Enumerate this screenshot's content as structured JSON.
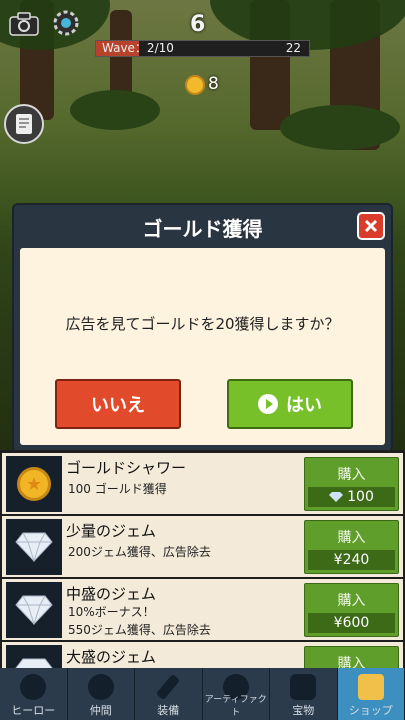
{
  "hud": {
    "stage_number": "6",
    "wave_label": "Wave：2/10",
    "wave_progress": 0.2,
    "wave_remaining": "22",
    "gold": "8"
  },
  "dialog": {
    "title": "ゴールド獲得",
    "message": "広告を見てゴールドを20獲得しますか？",
    "no_label": "いいえ",
    "yes_label": "はい"
  },
  "shop": {
    "items": [
      {
        "name": "ゴールドシャワー",
        "desc1": "100 ゴールド獲得",
        "desc2": "",
        "buy_label": "購入",
        "price": "100",
        "icon": "gold-coin-icon"
      },
      {
        "name": "少量のジェム",
        "desc1": "200ジェム獲得、広告除去",
        "desc2": "",
        "buy_label": "購入",
        "price": "¥240",
        "icon": "gem-icon"
      },
      {
        "name": "中盛のジェム",
        "desc1": "10%ボーナス！",
        "desc2": "550ジェム獲得、広告除去",
        "buy_label": "購入",
        "price": "¥600",
        "icon": "gem-icon"
      },
      {
        "name": "大盛のジェム",
        "desc1": "",
        "desc2": "",
        "buy_label": "購入",
        "price": "",
        "icon": "gem-icon"
      }
    ]
  },
  "tabs": [
    {
      "label": "ヒーロー",
      "icon": "hero-icon"
    },
    {
      "label": "仲間",
      "icon": "party-icon"
    },
    {
      "label": "装備",
      "icon": "sword-icon"
    },
    {
      "label": "アーティファクト",
      "icon": "artifact-icon"
    },
    {
      "label": "宝物",
      "icon": "treasure-icon"
    },
    {
      "label": "ショップ",
      "icon": "shop-icon"
    }
  ],
  "colors": {
    "no_button": "#e24a2c",
    "yes_button": "#77c02a",
    "buy_button": "#5f9e2a",
    "active_tab": "#3d8fc0"
  }
}
